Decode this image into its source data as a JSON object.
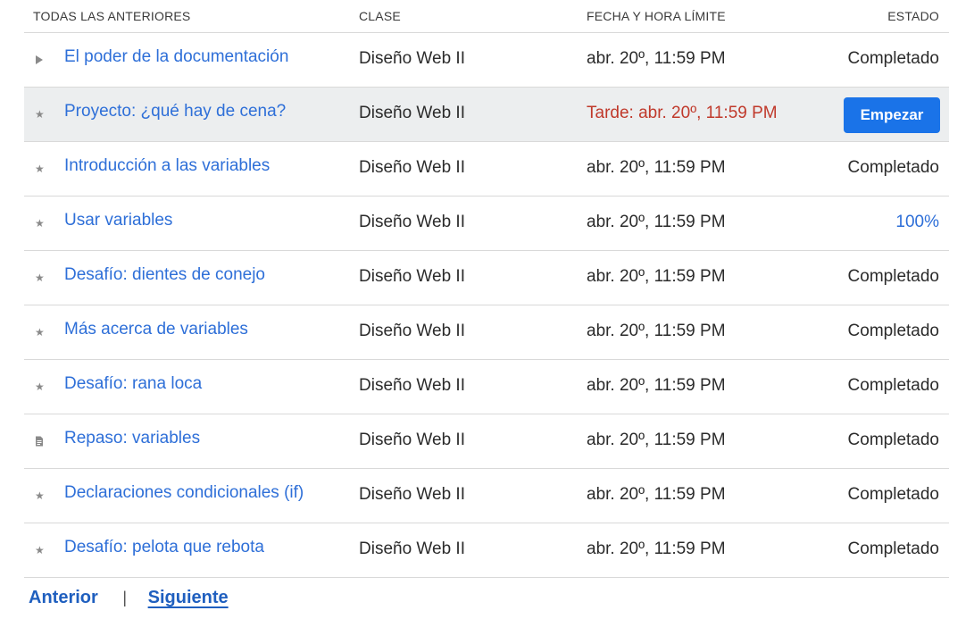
{
  "header": {
    "title": "TODAS LAS ANTERIORES",
    "class": "CLASE",
    "due": "FECHA Y HORA LÍMITE",
    "status": "ESTADO"
  },
  "rows": [
    {
      "icon": "play-triangle-icon",
      "title": "El poder de la documentación",
      "class": "Diseño Web II",
      "due": "abr. 20º, 11:59 PM",
      "status": "Completado"
    },
    {
      "icon": "star-icon",
      "title": "Proyecto: ¿qué hay de cena?",
      "class": "Diseño Web II",
      "due": "Tarde: abr. 20º, 11:59 PM",
      "status": "",
      "action": "Empezar",
      "late": true
    },
    {
      "icon": "star-icon",
      "title": "Introducción a las variables",
      "class": "Diseño Web II",
      "due": "abr. 20º, 11:59 PM",
      "status": "Completado"
    },
    {
      "icon": "star-icon",
      "title": "Usar variables",
      "class": "Diseño Web II",
      "due": "abr. 20º, 11:59 PM",
      "status": "100%"
    },
    {
      "icon": "star-icon",
      "title": "Desafío: dientes de conejo",
      "class": "Diseño Web II",
      "due": "abr. 20º, 11:59 PM",
      "status": "Completado"
    },
    {
      "icon": "star-icon",
      "title": "Más acerca de variables",
      "class": "Diseño Web II",
      "due": "abr. 20º, 11:59 PM",
      "status": "Completado"
    },
    {
      "icon": "star-icon",
      "title": "Desafío: rana loca",
      "class": "Diseño Web II",
      "due": "abr. 20º, 11:59 PM",
      "status": "Completado"
    },
    {
      "icon": "document-icon",
      "title": "Repaso: variables",
      "class": "Diseño Web II",
      "due": "abr. 20º, 11:59 PM",
      "status": "Completado"
    },
    {
      "icon": "star-icon",
      "title": "Declaraciones condicionales (if)",
      "class": "Diseño Web II",
      "due": "abr. 20º, 11:59 PM",
      "status": "Completado"
    },
    {
      "icon": "star-icon",
      "title": "Desafío: pelota que rebota",
      "class": "Diseño Web II",
      "due": "abr. 20º, 11:59 PM",
      "status": "Completado"
    }
  ],
  "pager": {
    "prev": "Anterior",
    "separator": "|",
    "next": "Siguiente"
  },
  "colors": {
    "link": "#2e6fd8",
    "late": "#c0392b",
    "button": "#1a73e8",
    "highlight_row": "#eceeef"
  }
}
